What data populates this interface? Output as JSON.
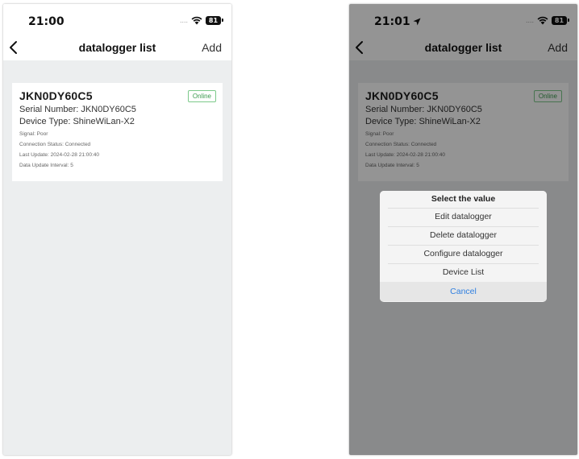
{
  "screens": [
    {
      "status_time": "21:00",
      "status_dots": "....",
      "battery": "81",
      "show_location_arrow": false,
      "nav": {
        "back": "back",
        "title": "datalogger list",
        "add": "Add"
      },
      "device": {
        "name": "JKN0DY60C5",
        "status_badge": "Online",
        "serial": "Serial Number: JKN0DY60C5",
        "type": "Device Type: ShineWiLan-X2",
        "signal": "Signal: Poor",
        "connection": "Connection Status: Connected",
        "last_update": "Last Update: 2024-02-28 21:00:40",
        "interval": "Data Update Interval: 5"
      }
    },
    {
      "status_time": "21:01",
      "status_dots": "....",
      "battery": "81",
      "show_location_arrow": true,
      "nav": {
        "back": "back",
        "title": "datalogger list",
        "add": "Add"
      },
      "device": {
        "name": "JKN0DY60C5",
        "status_badge": "Online",
        "serial": "Serial Number: JKN0DY60C5",
        "type": "Device Type: ShineWiLan-X2",
        "signal": "Signal: Poor",
        "connection": "Connection Status: Connected",
        "last_update": "Last Update: 2024-02-28 21:00:40",
        "interval": "Data Update Interval: 5"
      },
      "action_sheet": {
        "title": "Select the value",
        "items": [
          "Edit datalogger",
          "Delete datalogger",
          "Configure datalogger",
          "Device List"
        ],
        "cancel": "Cancel"
      }
    }
  ],
  "colors": {
    "badge_border": "#7cc98a",
    "badge_text": "#3a9a4e",
    "cancel_text": "#2f7fe0",
    "page_bg": "#eceeef"
  },
  "icons": {
    "back": "chevron-left-icon",
    "wifi": "wifi-icon",
    "battery": "battery-icon",
    "location": "location-arrow-icon"
  }
}
